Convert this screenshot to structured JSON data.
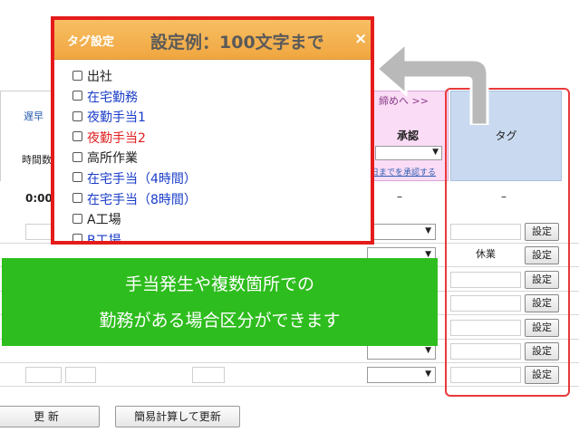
{
  "table": {
    "header_late": "遅早",
    "header_hours": "時間数",
    "time_value": "0:00",
    "approve_nav": "締めへ >>",
    "approve_title": "承認",
    "approve_select_arrow": "▼",
    "approve_link": "日までを承認する",
    "tag_title": "タグ",
    "dash": "–",
    "rows": [
      {
        "tag": "",
        "button": "設定"
      },
      {
        "tag": "休業",
        "button": "設定"
      },
      {
        "tag": "",
        "button": "設定"
      },
      {
        "tag": "",
        "button": "設定"
      },
      {
        "tag": "",
        "button": "設定"
      },
      {
        "tag": "",
        "button": "設定"
      },
      {
        "tag": "",
        "button": "設定"
      }
    ]
  },
  "footer": {
    "update_button": "更 新",
    "simple_calc_button": "簡易計算して更新"
  },
  "dialog": {
    "title": "タグ設定",
    "example": "設定例：100文字まで",
    "close": "×",
    "items": [
      {
        "label": "出社",
        "color": "black"
      },
      {
        "label": "在宅勤務",
        "color": "blue"
      },
      {
        "label": "夜勤手当1",
        "color": "blue"
      },
      {
        "label": "夜勤手当2",
        "color": "red"
      },
      {
        "label": "高所作業",
        "color": "black"
      },
      {
        "label": "在宅手当（4時間）",
        "color": "blue"
      },
      {
        "label": "在宅手当（8時間）",
        "color": "blue"
      },
      {
        "label": "A工場",
        "color": "black"
      },
      {
        "label": "B工場",
        "color": "blue"
      }
    ]
  },
  "banner": {
    "line1": "手当発生や複数箇所での",
    "line2": "勤務がある場合区分ができます"
  },
  "colors": {
    "dialog_header": "#f0a640",
    "highlight": "#e51b1b",
    "banner": "#2ebd1e",
    "approve_bg": "#fbdcf6",
    "tag_bg": "#c9daf0"
  }
}
